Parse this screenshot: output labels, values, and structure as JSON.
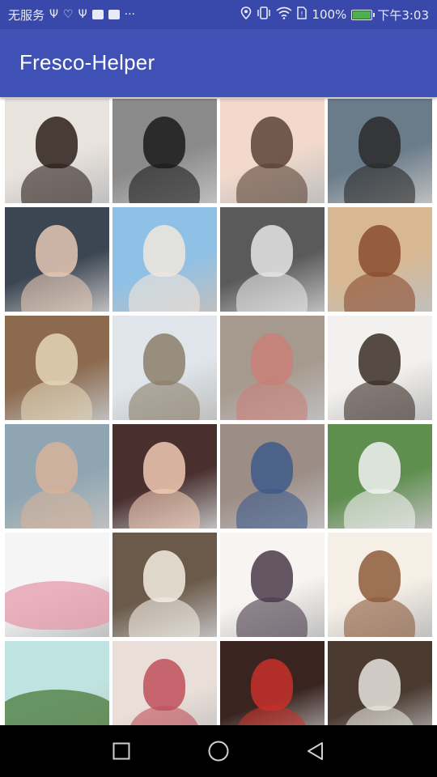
{
  "status_bar": {
    "carrier": "无服务",
    "battery_percent": "100%",
    "battery_level": 1.0,
    "time": "下午3:03",
    "left_icons": [
      "usb-icon",
      "health-icon",
      "usb-debug-icon",
      "app-icon",
      "app-icon-2",
      "more-icon"
    ],
    "right_icons": [
      "location-icon",
      "vibrate-icon",
      "wifi-icon",
      "sim-icon",
      "battery-icon"
    ]
  },
  "app_bar": {
    "title": "Fresco-Helper"
  },
  "gallery": {
    "columns": 4,
    "images": [
      {
        "icon": "portrait-photo",
        "bg": "#e9e3de",
        "accent": "#2b1f1a"
      },
      {
        "icon": "portrait-photo",
        "bg": "#8a8a8a",
        "accent": "#1a1a1a"
      },
      {
        "icon": "portrait-photo",
        "bg": "#f2d9cc",
        "accent": "#5c4236"
      },
      {
        "icon": "portrait-photo",
        "bg": "#6a7b8a",
        "accent": "#2a2a2a"
      },
      {
        "icon": "portrait-photo",
        "bg": "#3b4652",
        "accent": "#e5c8b4"
      },
      {
        "icon": "portrait-photo",
        "bg": "#8fc0e6",
        "accent": "#f0e6dc"
      },
      {
        "icon": "portrait-photo",
        "bg": "#5a5a5a",
        "accent": "#e6e6e6"
      },
      {
        "icon": "portrait-photo",
        "bg": "#d8b893",
        "accent": "#8a4b2e"
      },
      {
        "icon": "portrait-photo",
        "bg": "#8c6a4e",
        "accent": "#e4d6b8"
      },
      {
        "icon": "portrait-photo",
        "bg": "#dfe5ea",
        "accent": "#8c7f6a"
      },
      {
        "icon": "portrait-photo",
        "bg": "#a69a8e",
        "accent": "#c97f78"
      },
      {
        "icon": "portrait-photo",
        "bg": "#f3f1ef",
        "accent": "#3a2d26"
      },
      {
        "icon": "portrait-photo",
        "bg": "#8fa6b2",
        "accent": "#d7b39a"
      },
      {
        "icon": "portrait-photo",
        "bg": "#4a2f2f",
        "accent": "#f0c9b3"
      },
      {
        "icon": "portrait-photo",
        "bg": "#9c8d86",
        "accent": "#3e5a8a"
      },
      {
        "icon": "portrait-photo",
        "bg": "#5f8f4f",
        "accent": "#f2f2f2"
      },
      {
        "icon": "landscape-photo",
        "bg": "#f5f5f5",
        "accent": "#e39aa9"
      },
      {
        "icon": "portrait-photo",
        "bg": "#6b5a4a",
        "accent": "#f4ede2"
      },
      {
        "icon": "portrait-photo",
        "bg": "#f7f4f1",
        "accent": "#4a3b4a"
      },
      {
        "icon": "portrait-photo",
        "bg": "#f5efe6",
        "accent": "#8c5a3a"
      },
      {
        "icon": "landscape-photo",
        "bg": "#bfe3e0",
        "accent": "#4a7a3a"
      },
      {
        "icon": "portrait-photo",
        "bg": "#eadfd8",
        "accent": "#c0505a"
      },
      {
        "icon": "portrait-photo",
        "bg": "#3a2420",
        "accent": "#c8302a"
      },
      {
        "icon": "portrait-photo",
        "bg": "#4a3a30",
        "accent": "#e8e4de"
      }
    ]
  },
  "nav_bar": {
    "buttons": [
      "recent-apps-icon",
      "home-icon",
      "back-icon"
    ]
  }
}
